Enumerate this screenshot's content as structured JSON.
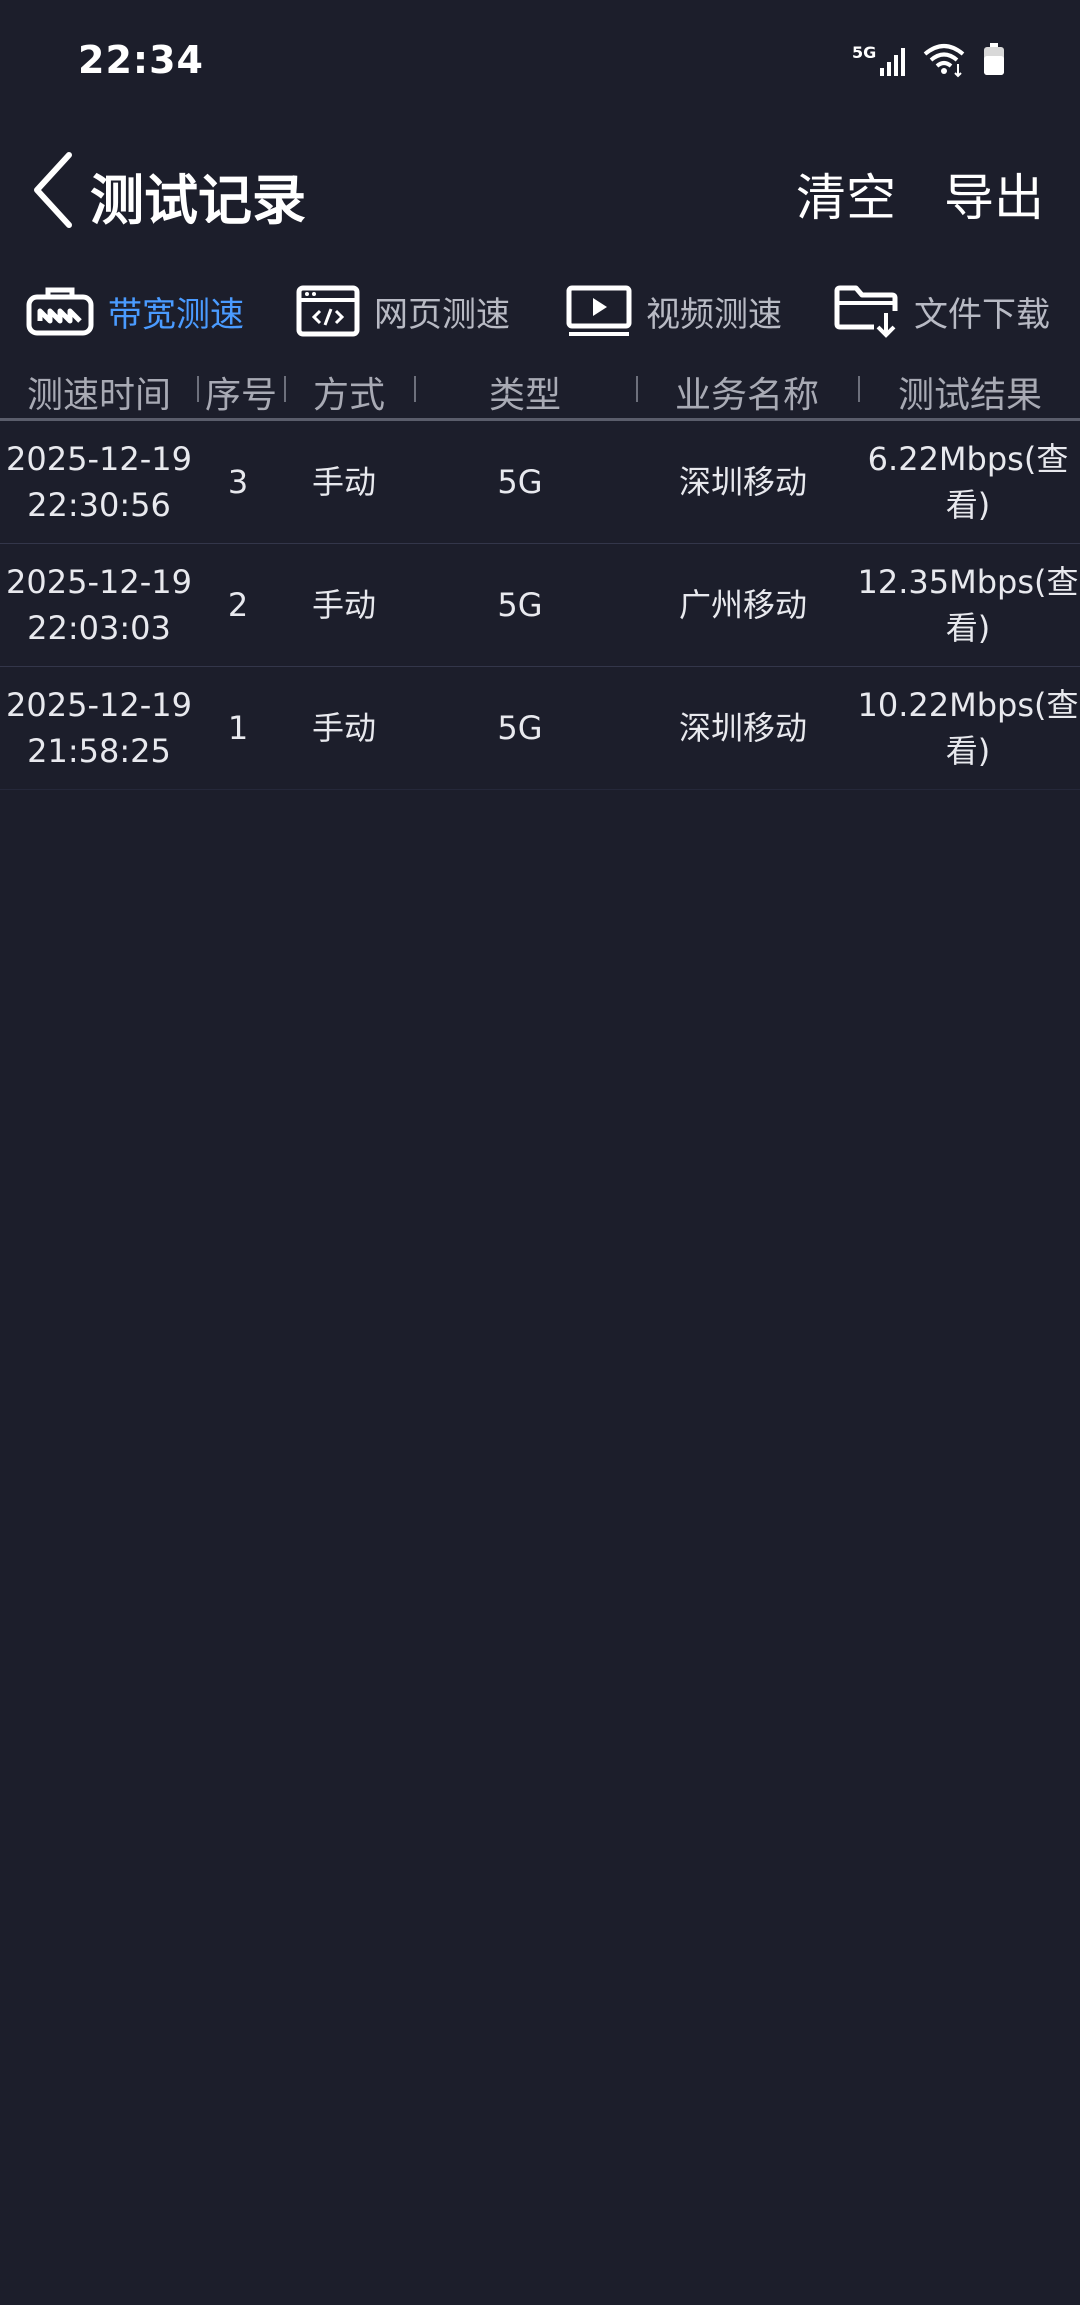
{
  "status_bar": {
    "time": "22:34",
    "network": "5G",
    "icons": [
      "signal-5g-icon",
      "wifi-icon",
      "battery-icon"
    ]
  },
  "header": {
    "title": "测试记录",
    "back_icon": "back-chevron-icon",
    "clear_label": "清空",
    "export_label": "导出"
  },
  "tabs": [
    {
      "label": "带宽测速",
      "icon": "bandwidth-icon",
      "active": true
    },
    {
      "label": "网页测速",
      "icon": "webpage-code-icon",
      "active": false
    },
    {
      "label": "视频测速",
      "icon": "video-play-icon",
      "active": false
    },
    {
      "label": "文件下载",
      "icon": "folder-download-icon",
      "active": false
    }
  ],
  "table": {
    "columns": [
      "测速时间",
      "序号",
      "方式",
      "类型",
      "业务名称",
      "测试结果"
    ],
    "rows": [
      {
        "date": "2025-12-19",
        "time": "22:30:56",
        "seq": "3",
        "mode": "手动",
        "type": "5G",
        "name": "深圳移动",
        "result_line1": "6.22Mbps(查",
        "result_line2": "看)"
      },
      {
        "date": "2025-12-19",
        "time": "22:03:03",
        "seq": "2",
        "mode": "手动",
        "type": "5G",
        "name": "广州移动",
        "result_line1": "12.35Mbps(查",
        "result_line2": "看)"
      },
      {
        "date": "2025-12-19",
        "time": "21:58:25",
        "seq": "1",
        "mode": "手动",
        "type": "5G",
        "name": "深圳移动",
        "result_line1": "10.22Mbps(查",
        "result_line2": "看)"
      }
    ]
  },
  "colors": {
    "background": "#1c1e2b",
    "accent": "#4a9bff",
    "text": "#ffffff",
    "muted": "#a8aab4"
  }
}
